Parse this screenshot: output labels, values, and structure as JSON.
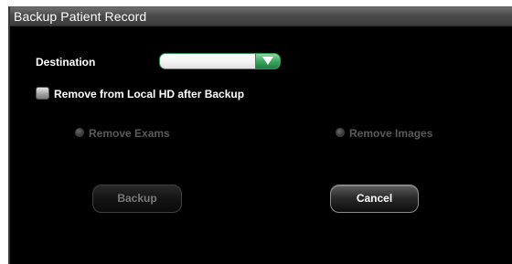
{
  "dialog": {
    "title": "Backup Patient Record"
  },
  "destination": {
    "label": "Destination",
    "value": ""
  },
  "remove_local": {
    "label": "Remove from Local HD after Backup",
    "checked": false
  },
  "options": {
    "remove_exams_label": "Remove Exams",
    "remove_images_label": "Remove Images"
  },
  "buttons": {
    "backup_label": "Backup",
    "cancel_label": "Cancel"
  },
  "colors": {
    "background": "#000000",
    "accent": "#3da863",
    "disabled_text": "#5a5a5a"
  }
}
